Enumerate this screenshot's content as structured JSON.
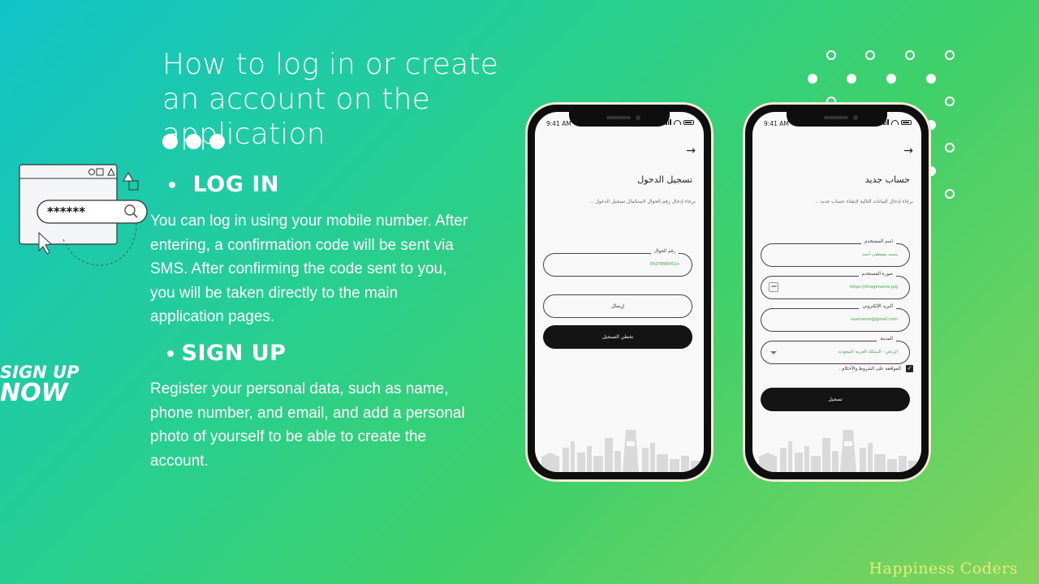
{
  "heading": {
    "title": "How to log in or create an account on the application"
  },
  "login": {
    "heading": "LOG IN",
    "text": "You can log in using your mobile number. After entering, a confirmation code will be sent via SMS. After confirming the code sent to you, you will be taken directly to the main application pages."
  },
  "signup": {
    "heading": "SIGN UP",
    "text": "Register your personal data, such as name, phone number, and email, and add a personal photo of yourself to be able to create the account."
  },
  "illustration": {
    "password_mask": "******"
  },
  "logo": {
    "line1": "SIGN UP",
    "line2": "NOW"
  },
  "phone_login": {
    "time": "9:41 AM",
    "title": "تسجيل الدخول",
    "subtitle": "برجاء إدخال رقم الجوال لاستكمال تسجيل الدخول ..",
    "phone_label": "رقم الجوال",
    "phone_value": "+0507896452",
    "send_button": "إرسال",
    "skip_button": "تخطي التسجيل"
  },
  "phone_signup": {
    "time": "9:41 AM",
    "title": "حساب جديد",
    "subtitle": "برجاء إدخال البيانات التالية لإنشاء حساب جديد ..",
    "fields": [
      {
        "label": "اسم المستخدم",
        "value": "محمد مصطفى أحمد"
      },
      {
        "label": "صورة المستخدم",
        "value": "https://imagename.jpg"
      },
      {
        "label": "البريد الإلكتروني",
        "value": "username@gmail.com"
      },
      {
        "label": "المدينة",
        "value": "الرياض - المملكة العربية السعودية"
      }
    ],
    "terms": "الموافقة على الشروط والأحكام .",
    "submit_button": "تسجيل"
  },
  "brand": "Happiness Coders",
  "colors": {
    "accent_green": "#3aa94a",
    "brand_yellow": "#e7eb7a"
  }
}
